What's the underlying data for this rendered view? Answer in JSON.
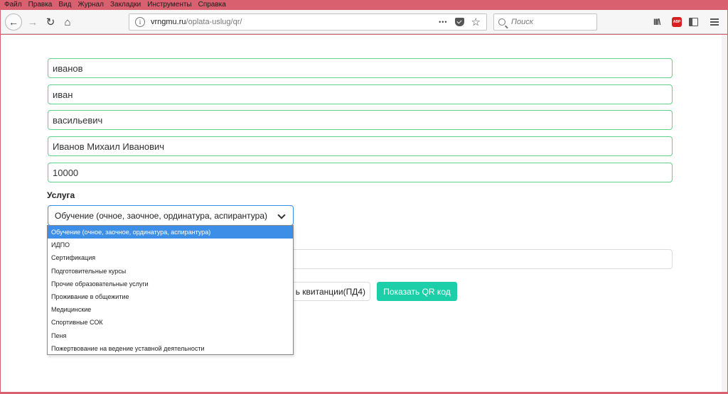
{
  "menu": [
    "Файл",
    "Правка",
    "Вид",
    "Журнал",
    "Закладки",
    "Инструменты",
    "Справка"
  ],
  "url": {
    "domain": "vrngmu.ru",
    "path": "/oplata-uslug/qr/"
  },
  "search": {
    "placeholder": "Поиск"
  },
  "toolbar_icons": {
    "more": "•••",
    "star": "☆",
    "abp": "ABP",
    "library": "III\\"
  },
  "form": {
    "fields": [
      "иванов",
      "иван",
      "васильевич",
      "Иванов Михаил Иванович",
      "10000"
    ],
    "service_label": "Услуга",
    "service_selected": "Обучение (очное, заочное, ординатура, аспирантура)",
    "options": [
      "Обучение (очное, заочное, ординатура, аспирантура)",
      "ИДПО",
      "Сертификация",
      "Подготовительные курсы",
      "Прочие образовательные услуги",
      "Проживание в общежитие",
      "Медицинские",
      "Спортивные СОК",
      "Пеня",
      "Пожертвование на ведение уставной деятельности"
    ],
    "pd4_button_visible": "ь квитанции(ПД4)",
    "qr_button": "Показать QR код"
  },
  "colors": {
    "frame": "#d9616f",
    "field_border": "#5fd189",
    "select_border": "#3c8ee6",
    "qr_button": "#1ccfa8"
  }
}
